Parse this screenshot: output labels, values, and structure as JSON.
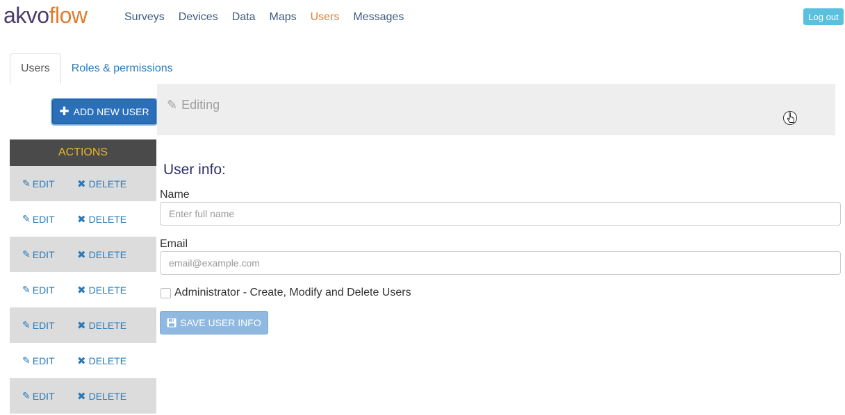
{
  "logo": {
    "part1": "akvo",
    "part2": "flow"
  },
  "nav": {
    "surveys": "Surveys",
    "devices": "Devices",
    "data": "Data",
    "maps": "Maps",
    "users": "Users",
    "messages": "Messages"
  },
  "logout_label": "Log out",
  "tabs": {
    "users": "Users",
    "roles": "Roles & permissions"
  },
  "add_user_label": "ADD NEW USER",
  "actions_header": "ACTIONS",
  "row_actions": {
    "edit": "EDIT",
    "delete": "DELETE"
  },
  "rows_count_visible": 7,
  "editing_label": "Editing",
  "form": {
    "title": "User info:",
    "name_label": "Name",
    "name_placeholder": "Enter full name",
    "email_label": "Email",
    "email_placeholder": "email@example.com",
    "admin_label": "Administrator - Create, Modify and Delete Users",
    "save_label": "SAVE USER INFO"
  },
  "colors": {
    "brand_purple": "#4b3a6b",
    "brand_orange": "#e27c2a",
    "link_blue": "#2a7ab9",
    "primary_button": "#2a6fb8",
    "logout_button": "#5bc0de",
    "actions_header_bg": "#4a4a4a",
    "actions_header_text": "#e9b72b"
  }
}
